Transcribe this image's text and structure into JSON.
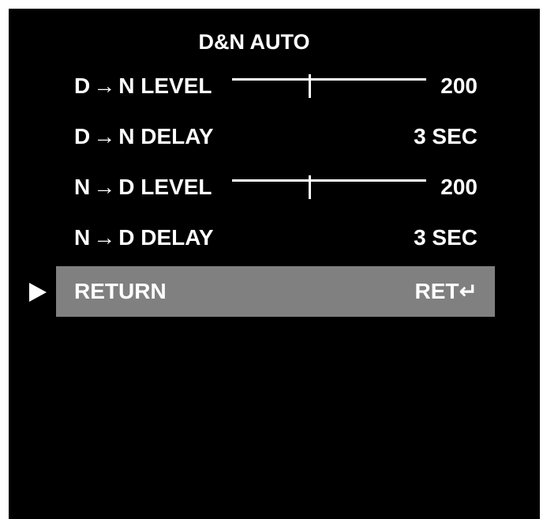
{
  "menu": {
    "title": "D&N AUTO",
    "arrow_glyph": "→",
    "items": [
      {
        "prefix": "D",
        "suffix": "N LEVEL",
        "value": "200",
        "slider_level": 0.4
      },
      {
        "prefix": "D",
        "suffix": "N DELAY",
        "value": "3 SEC"
      },
      {
        "prefix": "N",
        "suffix": "D LEVEL",
        "value": "200",
        "slider_level": 0.4
      },
      {
        "prefix": "N",
        "suffix": "D DELAY",
        "value": "3 SEC"
      },
      {
        "label": "RETURN",
        "value": "RET↵",
        "selected": true
      }
    ],
    "pointer_icon": "play-triangle-icon",
    "colors": {
      "background": "#000000",
      "text": "#ffffff",
      "selected_bar": "#808080"
    }
  }
}
